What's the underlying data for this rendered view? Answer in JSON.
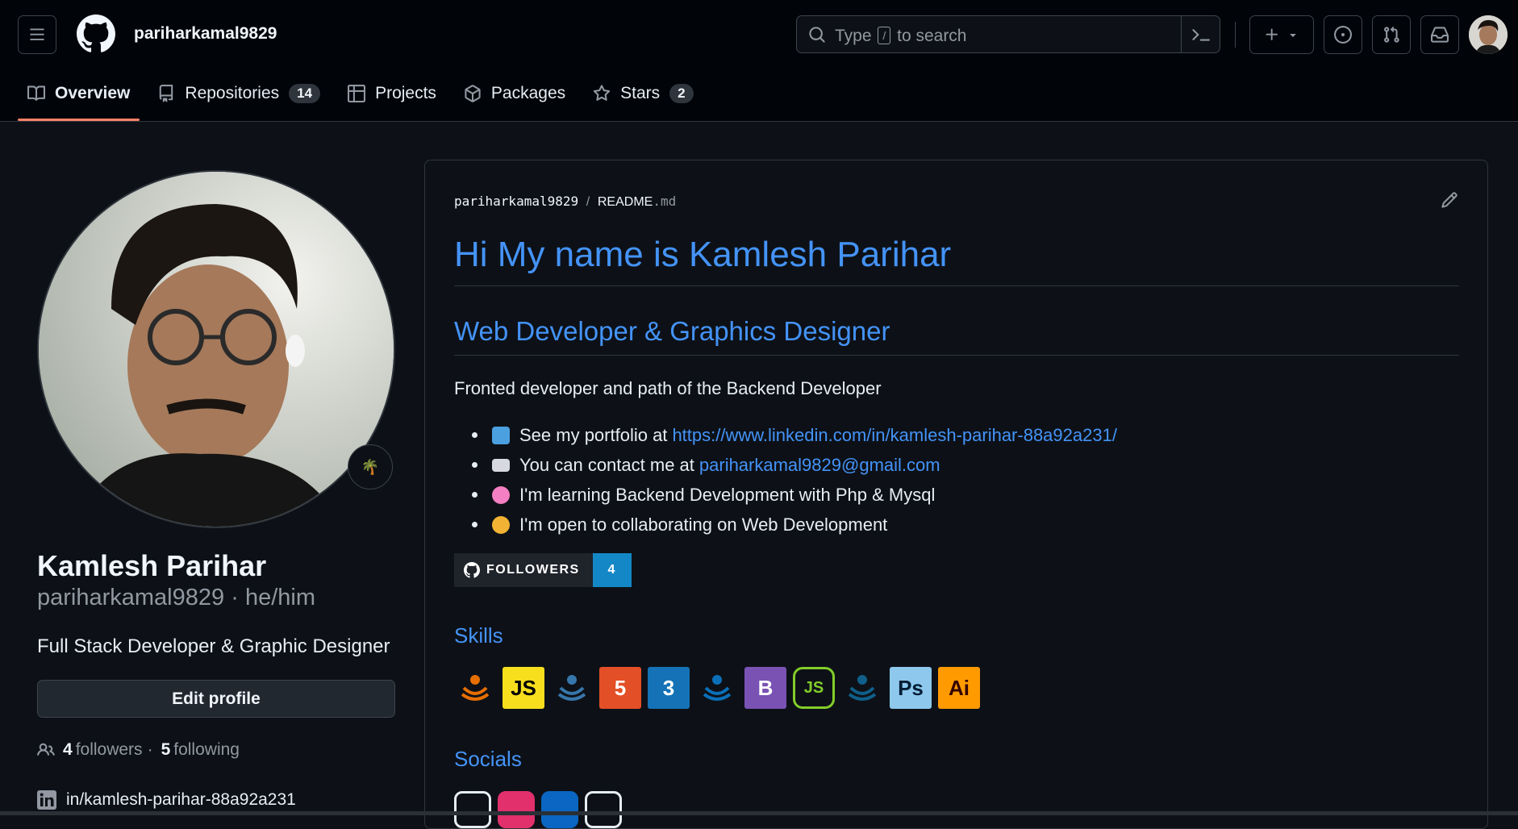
{
  "header": {
    "username": "pariharkamal9829",
    "search_placeholder_pre": "Type",
    "search_placeholder_key": "/",
    "search_placeholder_post": "to search"
  },
  "tabs": [
    {
      "label": "Overview",
      "count": null
    },
    {
      "label": "Repositories",
      "count": "14"
    },
    {
      "label": "Projects",
      "count": null
    },
    {
      "label": "Packages",
      "count": null
    },
    {
      "label": "Stars",
      "count": "2"
    }
  ],
  "profile": {
    "status_emoji": "🌴",
    "name": "Kamlesh Parihar",
    "login": "pariharkamal9829",
    "pronouns": "he/him",
    "bio": "Full Stack Developer & Graphic Designer",
    "edit_label": "Edit profile",
    "followers_count": "4",
    "followers_label": "followers",
    "dot": "·",
    "following_count": "5",
    "following_label": "following",
    "linkedin": "in/kamlesh-parihar-88a92a231"
  },
  "readme": {
    "owner": "pariharkamal9829",
    "sep": "/",
    "file": "README",
    "ext": ".md",
    "h1": "Hi My name is Kamlesh Parihar",
    "h2": "Web Developer & Graphics Designer",
    "intro": "Fronted developer and path of the Backend Developer",
    "items": [
      {
        "text": "See my portfolio at",
        "link": "https://www.linkedin.com/in/kamlesh-parihar-88a92a231/",
        "emoji_color": "#4ba0e0"
      },
      {
        "text": "You can contact me at",
        "link": "pariharkamal9829@gmail.com",
        "emoji_color": "#d8d8e0"
      },
      {
        "text": "I'm learning Backend Development with Php & Mysql",
        "link": "",
        "emoji_color": "#f47fc2"
      },
      {
        "text": "I'm open to collaborating on Web Development",
        "link": "",
        "emoji_color": "#f2b233"
      }
    ],
    "badge_label": "FOLLOWERS",
    "badge_count": "4",
    "skills_heading": "Skills",
    "skills": [
      {
        "name": "java-icon",
        "label": "",
        "bg": "transparent",
        "fg": "#e76f00"
      },
      {
        "name": "javascript-icon",
        "label": "JS",
        "bg": "#f7df1e",
        "fg": "#000000"
      },
      {
        "name": "python-icon",
        "label": "",
        "bg": "transparent",
        "fg": "#3776ab"
      },
      {
        "name": "html5-icon",
        "label": "5",
        "bg": "#e34f26",
        "fg": "#ffffff"
      },
      {
        "name": "css3-icon",
        "label": "3",
        "bg": "#1572b6",
        "fg": "#ffffff"
      },
      {
        "name": "mysql-icon",
        "label": "",
        "bg": "transparent",
        "fg": "#0b6fb8"
      },
      {
        "name": "bootstrap-icon",
        "label": "B",
        "bg": "#7952b3",
        "fg": "#ffffff"
      },
      {
        "name": "nodejs-icon",
        "label": "JS",
        "bg": "transparent",
        "fg": "#83cd29"
      },
      {
        "name": "mysql-dolphin-icon",
        "label": "",
        "bg": "transparent",
        "fg": "#0f5f8a"
      },
      {
        "name": "photoshop-icon",
        "label": "Ps",
        "bg": "#8ec8ed",
        "fg": "#001d34"
      },
      {
        "name": "illustrator-icon",
        "label": "Ai",
        "bg": "#ff9a00",
        "fg": "#330000"
      }
    ],
    "socials_heading": "Socials",
    "socials": [
      {
        "name": "github-social-icon",
        "color": "#0d1117"
      },
      {
        "name": "instagram-social-icon",
        "color": "#e1306c"
      },
      {
        "name": "linkedin-social-icon",
        "color": "#0a66c2"
      },
      {
        "name": "x-social-icon",
        "color": "#0d1117"
      }
    ]
  },
  "colors": {
    "accent": "#4493f8",
    "tab_underline": "#f78166",
    "bg": "#0d1117",
    "header_bg": "#010409"
  }
}
